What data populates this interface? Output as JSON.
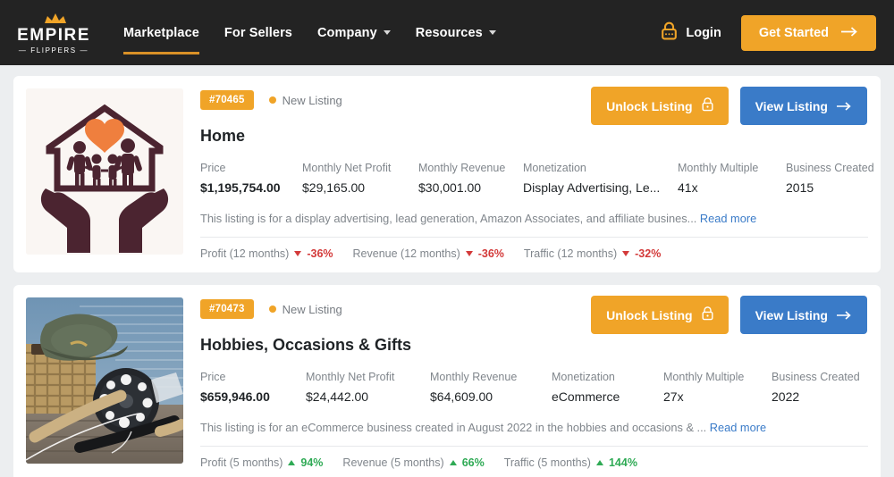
{
  "header": {
    "logo": {
      "name": "EMPIRE",
      "sub": "FLIPPERS",
      "crown_icon": "crown-icon"
    },
    "nav": [
      {
        "label": "Marketplace",
        "active": true,
        "has_caret": false
      },
      {
        "label": "For Sellers",
        "active": false,
        "has_caret": false
      },
      {
        "label": "Company",
        "active": false,
        "has_caret": true
      },
      {
        "label": "Resources",
        "active": false,
        "has_caret": true
      }
    ],
    "login_label": "Login",
    "login_icon": "lock-icon",
    "get_started_label": "Get Started",
    "get_started_icon": "arrow-right-icon",
    "colors": {
      "bar": "#232323",
      "accent": "#f0a428",
      "link": "#3a7bc8"
    }
  },
  "listings": [
    {
      "badge": "#70465",
      "status": "New Listing",
      "title": "Home",
      "thumb_icon": "hands-holding-house-with-family-illustration",
      "unlock_label": "Unlock Listing",
      "view_label": "View Listing",
      "metrics": [
        {
          "label": "Price",
          "value": "$1,195,754.00"
        },
        {
          "label": "Monthly Net Profit",
          "value": "$29,165.00"
        },
        {
          "label": "Monthly Revenue",
          "value": "$30,001.00"
        },
        {
          "label": "Monetization",
          "value": "Display Advertising, Le..."
        },
        {
          "label": "Monthly Multiple",
          "value": "41x"
        },
        {
          "label": "Business Created",
          "value": "2015"
        }
      ],
      "description": "This listing is for a display advertising, lead generation, Amazon Associates, and affiliate busines...",
      "read_more": "Read more",
      "stats": [
        {
          "label": "Profit (12 months)",
          "pct": "-36%",
          "dir": "down"
        },
        {
          "label": "Revenue (12 months)",
          "pct": "-36%",
          "dir": "down"
        },
        {
          "label": "Traffic (12 months)",
          "pct": "-32%",
          "dir": "down"
        }
      ]
    },
    {
      "badge": "#70473",
      "status": "New Listing",
      "title": "Hobbies, Occasions & Gifts",
      "thumb_icon": "fly-fishing-reel-rod-and-hat-photo",
      "unlock_label": "Unlock Listing",
      "view_label": "View Listing",
      "metrics": [
        {
          "label": "Price",
          "value": "$659,946.00"
        },
        {
          "label": "Monthly Net Profit",
          "value": "$24,442.00"
        },
        {
          "label": "Monthly Revenue",
          "value": "$64,609.00"
        },
        {
          "label": "Monetization",
          "value": "eCommerce"
        },
        {
          "label": "Monthly Multiple",
          "value": "27x"
        },
        {
          "label": "Business Created",
          "value": "2022"
        }
      ],
      "description": "This listing is for an eCommerce business created in August 2022 in the hobbies and occasions & ...",
      "read_more": "Read more",
      "stats": [
        {
          "label": "Profit (5 months)",
          "pct": "94%",
          "dir": "up"
        },
        {
          "label": "Revenue (5 months)",
          "pct": "66%",
          "dir": "up"
        },
        {
          "label": "Traffic (5 months)",
          "pct": "144%",
          "dir": "up"
        }
      ]
    }
  ]
}
